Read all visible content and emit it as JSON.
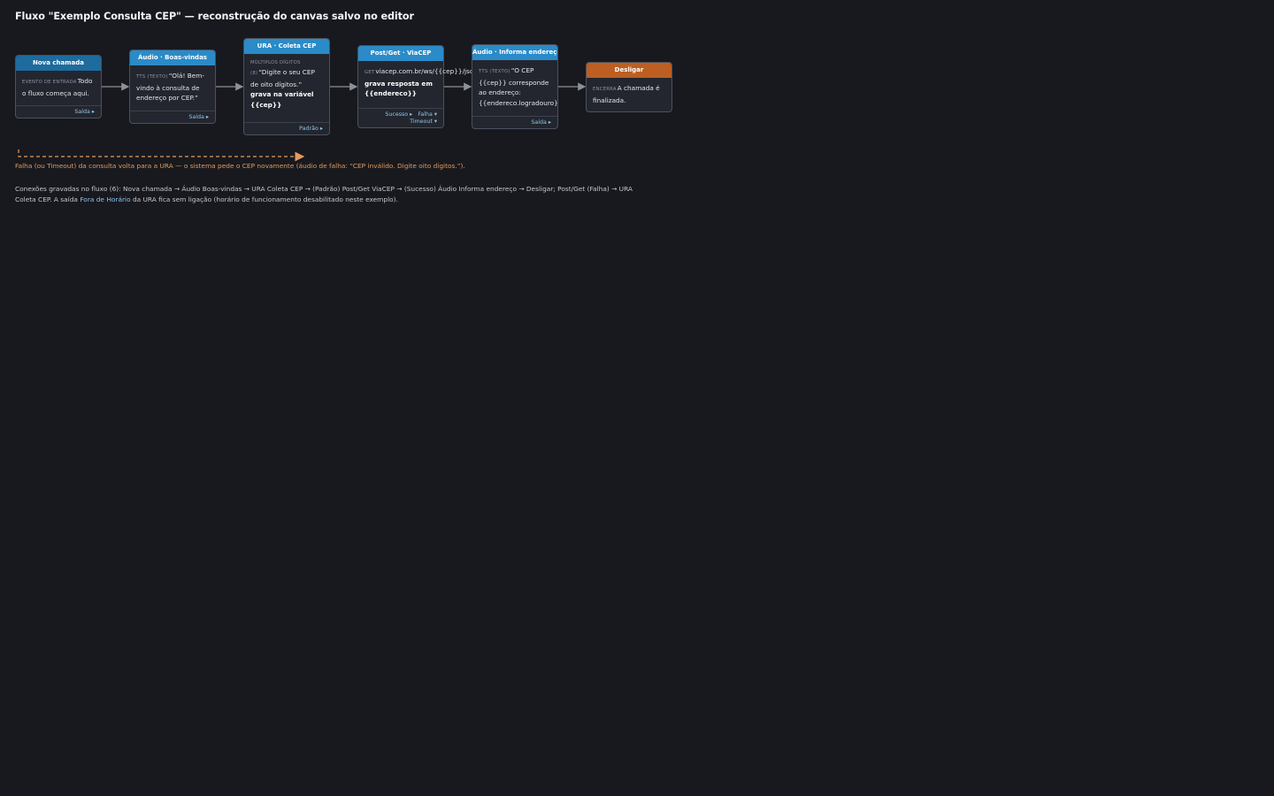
{
  "page": {
    "title": "Fluxo \"Exemplo Consulta CEP\" — reconstrução do canvas salvo no editor"
  },
  "colors": {
    "background": "#18191e",
    "node_body": "#23262e",
    "header_dark_blue": "#1e6b9e",
    "header_blue": "#2a8bc8",
    "header_orange": "#bd5f22",
    "connector": "#8b909a",
    "failure_path": "#e29a5d",
    "port_text": "#8fc4ec"
  },
  "nodes": {
    "nova_chamada": {
      "title": "Nova chamada",
      "tag": "EVENTO DE ENTRADA",
      "text": "Todo o fluxo começa aqui.",
      "out": "Saída ▸"
    },
    "boas_vindas": {
      "title": "Áudio · Boas-vindas",
      "tag": "TTS (TEXTO)",
      "text": "“Olá! Bem-vindo à consulta de endereço por CEP.”",
      "out": "Saída ▸"
    },
    "ura": {
      "title": "URA · Coleta CEP",
      "tag": "MÚLTIPLOS DÍGITOS",
      "digits_tag": "(8)",
      "text": "“Digite o seu CEP de oito dígitos.”",
      "save_text": "grava na variável {{cep}}",
      "out": "Padrão ▸"
    },
    "viacep": {
      "title": "Post/Get · ViaCEP",
      "method": "GET",
      "url": "viacep.com.br/ws/{{cep}}/json",
      "save_text": "grava resposta em {{endereco}}",
      "out_success": "Sucesso ▸",
      "out_fail": "Falha ▾",
      "out_timeout": "Timeout ▾"
    },
    "informa": {
      "title": "Áudio · Informa endereço",
      "tag": "TTS (TEXTO)",
      "text": "“O CEP {{cep}} corresponde ao endereço: {{endereco.logradouro}}...”",
      "out": "Saída ▸"
    },
    "desligar": {
      "title": "Desligar",
      "tag": "ENCERRA",
      "text": "A chamada é finalizada."
    }
  },
  "notes": {
    "failure": "Falha (ou Timeout) da consulta volta para a URA — o sistema pede o CEP novamente (áudio de falha: “CEP inválido. Digite oito dígitos.”).",
    "connections_prefix": "Conexões gravadas no fluxo (6): Nova chamada → Áudio Boas-vindas → URA Coleta CEP → (Padrão) Post/Get ViaCEP → (Sucesso) Áudio Informa endereço → Desligar; Post/Get (Falha) → URA Coleta CEP. A saída",
    "connections_link": "Fora de Horário",
    "connections_suffix": "da URA fica sem ligação (horário de funcionamento desabilitado neste exemplo)."
  }
}
